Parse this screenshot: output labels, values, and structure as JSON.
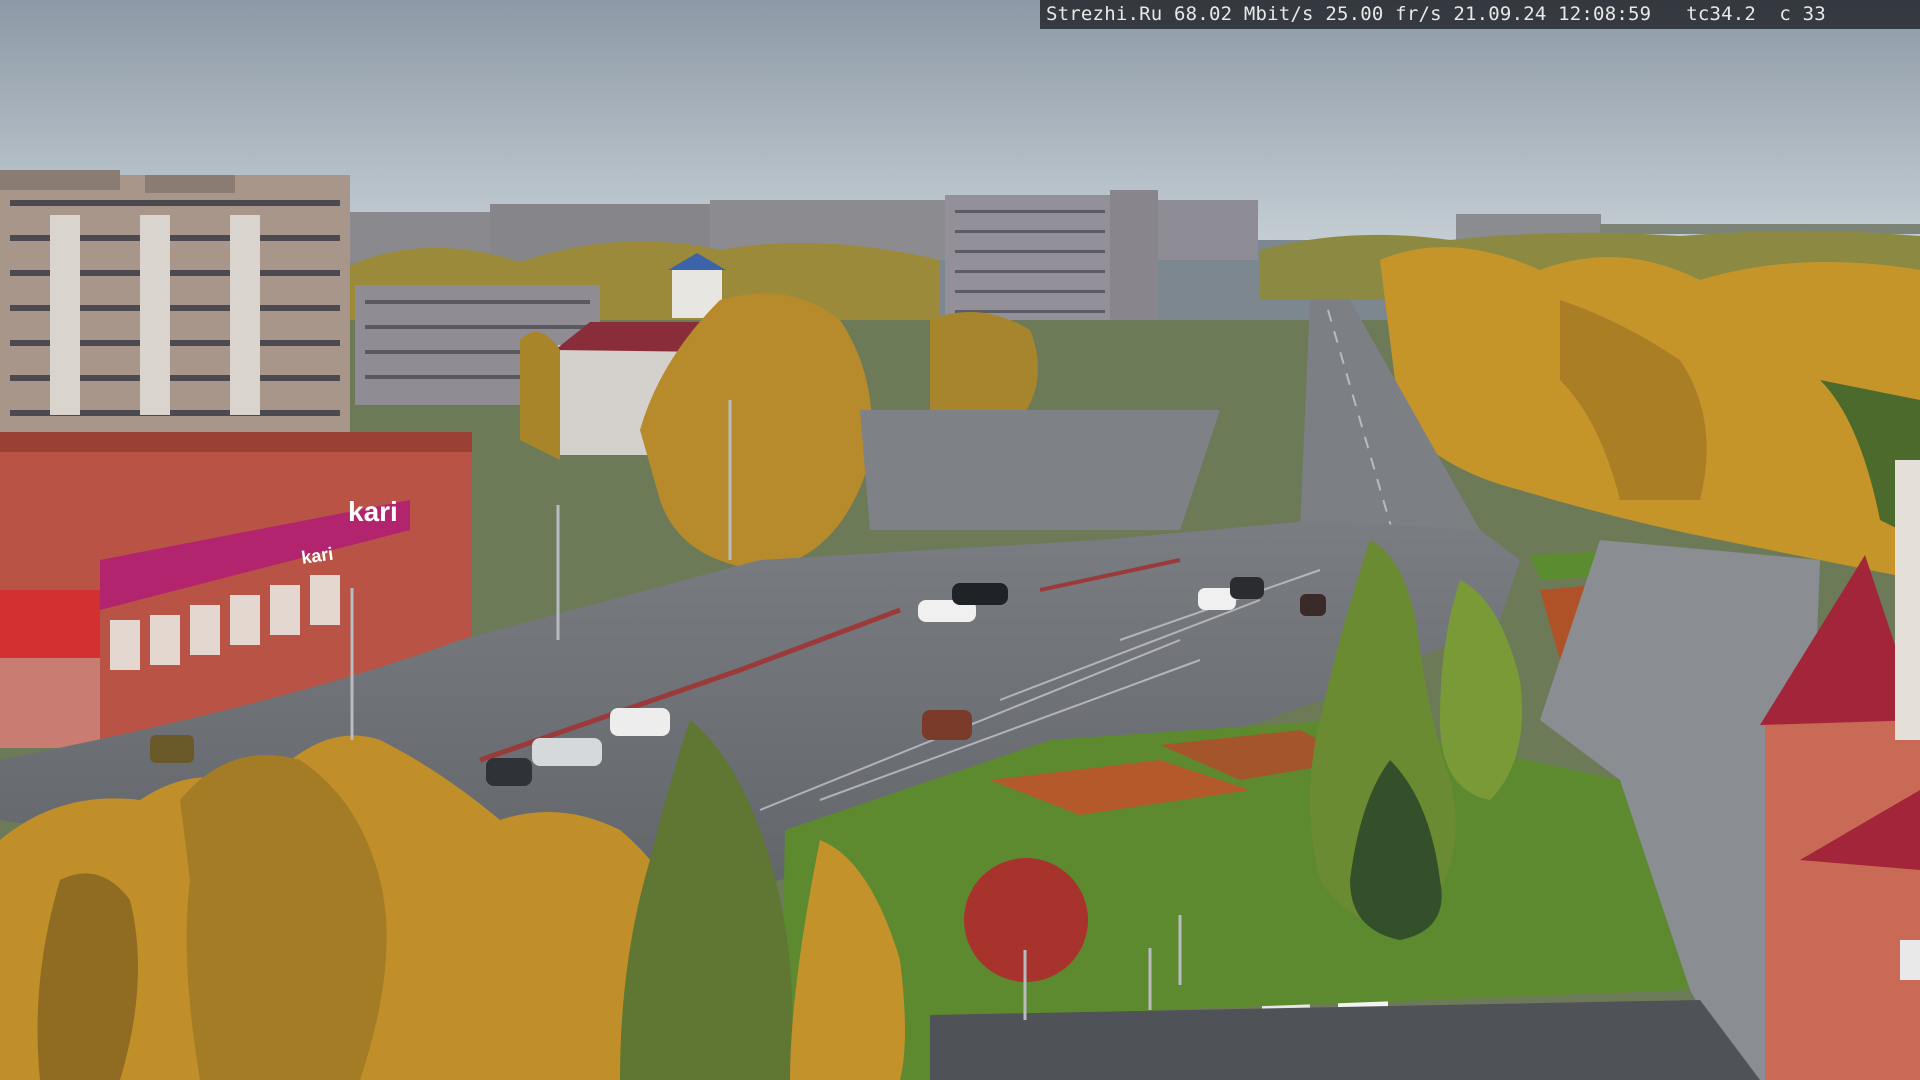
{
  "overlay": {
    "site": "Strezhi.Ru",
    "bitrate": "68.02 Mbit/s",
    "framerate": "25.00 fr/s",
    "date": "21.09.24",
    "time": "12:08:59",
    "tc": "tc34.2",
    "c": "c 33"
  },
  "store_sign": {
    "text": "kari",
    "text_small": "kari"
  },
  "colors": {
    "sky": "#b4bfc8",
    "road": "#6e7176",
    "foliage_gold": "#c79a2c",
    "foliage_green": "#5f7d34",
    "store_magenta": "#b3246e",
    "brick_red": "#c4584a",
    "grass": "#5c8a2e"
  }
}
